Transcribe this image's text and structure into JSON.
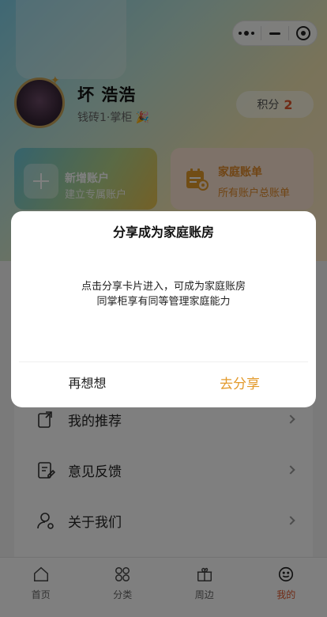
{
  "profile": {
    "name": "坏 浩浩",
    "level": "钱砖1·掌柜",
    "points_label": "积分",
    "points_value": "2"
  },
  "cards": [
    {
      "title": "新增账户",
      "subtitle": "建立专属账户"
    },
    {
      "title": "家庭账单",
      "subtitle": "所有账户总账单"
    }
  ],
  "menu": [
    {
      "label": "我的推荐",
      "icon": "share-doc-icon"
    },
    {
      "label": "意见反馈",
      "icon": "feedback-icon"
    },
    {
      "label": "关于我们",
      "icon": "user-icon"
    }
  ],
  "tabs": [
    {
      "label": "首页",
      "icon": "home-icon"
    },
    {
      "label": "分类",
      "icon": "grid-icon"
    },
    {
      "label": "周边",
      "icon": "gift-icon"
    },
    {
      "label": "我的",
      "icon": "smile-icon",
      "active": true
    }
  ],
  "modal": {
    "title": "分享成为家庭账房",
    "line1": "点击分享卡片进入，可成为家庭账房",
    "line2": "同掌柜享有同等管理家庭能力",
    "cancel_label": "再想想",
    "confirm_label": "去分享"
  },
  "colors": {
    "accent": "#e39a2b",
    "active_tab": "#e0572d",
    "points": "#e0572d"
  }
}
